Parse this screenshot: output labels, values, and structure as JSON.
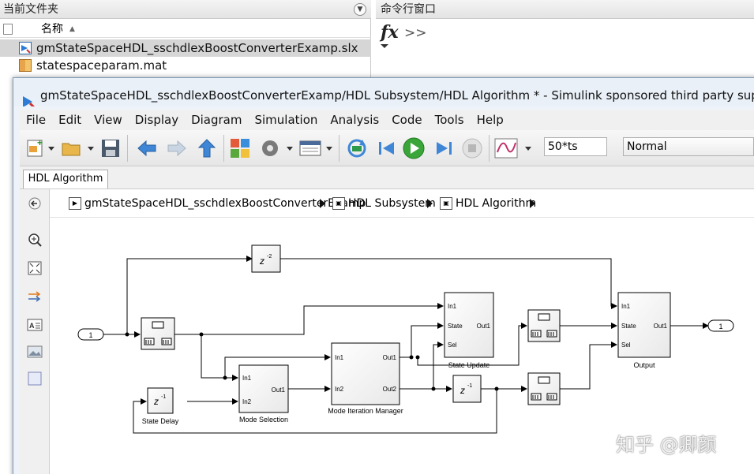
{
  "folder": {
    "title": "当前文件夹",
    "col_name": "名称",
    "files": [
      "gmStateSpaceHDL_sschdlexBoostConverterExamp.slx",
      "statespaceparam.mat"
    ]
  },
  "command_window": {
    "title": "命令行窗口",
    "fx": "fx",
    "prompt": ">>"
  },
  "window": {
    "title": "gmStateSpaceHDL_sschdlexBoostConverterExamp/HDL Subsystem/HDL Algorithm * - Simulink sponsored third party support use"
  },
  "menu": [
    "File",
    "Edit",
    "View",
    "Display",
    "Diagram",
    "Simulation",
    "Analysis",
    "Code",
    "Tools",
    "Help"
  ],
  "toolbar": {
    "stop_time": "50*ts",
    "sim_mode": "Normal"
  },
  "tab": {
    "label": "HDL Algorithm"
  },
  "breadcrumb": [
    "gmStateSpaceHDL_sschdlexBoostConverterExamp",
    "HDL Subsystem",
    "HDL Algorithm"
  ],
  "diagram": {
    "inport": "1",
    "outport": "1",
    "delay_top": "z",
    "delay_top_exp": "-2",
    "delay_mid": "z",
    "delay_mid_exp": "-1",
    "state_delay": "z",
    "state_delay_exp": "-1",
    "state_delay_label": "State Delay",
    "mode_selection": {
      "label": "Mode Selection",
      "in1": "In1",
      "in2": "In2",
      "out1": "Out1"
    },
    "mode_iteration": {
      "label": "Mode Iteration Manager",
      "in1": "In1",
      "in2": "In2",
      "out1": "Out1",
      "out2": "Out2"
    },
    "state_update": {
      "label": "State Update",
      "in1": "In1",
      "state": "State",
      "sel": "Sel",
      "out1": "Out1"
    },
    "output": {
      "label": "Output",
      "in1": "In1",
      "state": "State",
      "sel": "Sel",
      "out1": "Out1"
    }
  },
  "watermark": "知乎 @卿颜"
}
